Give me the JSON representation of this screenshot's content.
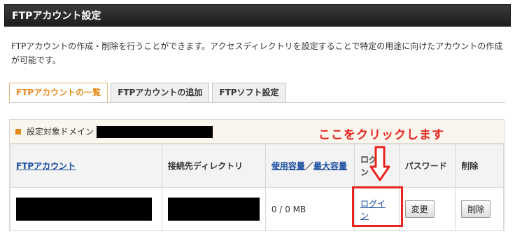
{
  "header": {
    "title": "FTPアカウント設定"
  },
  "description": "FTPアカウントの作成・削除を行うことができます。アクセスディレクトリを設定することで特定の用途に向けたアカウントの作成が可能です。",
  "tabs": [
    {
      "label": "FTPアカウントの一覧",
      "active": true
    },
    {
      "label": "FTPアカウントの追加",
      "active": false
    },
    {
      "label": "FTPソフト設定",
      "active": false
    }
  ],
  "panel": {
    "domain_label": "設定対象ドメイン"
  },
  "table": {
    "col_account": "FTPアカウント",
    "col_directory": "接続先ディレクトリ",
    "col_usage": "使用容量",
    "col_sep": "／",
    "col_max": "最大容量",
    "col_login": "ログイン",
    "col_password": "パスワード",
    "col_delete": "削除",
    "rows": [
      {
        "usage": "0 / 0 MB",
        "login_link": "ログイン",
        "change_button": "変更",
        "delete_button": "削除"
      }
    ]
  },
  "annotation": {
    "text": "ここをクリックします",
    "color": "#e8241e"
  },
  "colors": {
    "accent": "#e8891d",
    "link": "#1a4ca0",
    "annotation": "#e8241e"
  }
}
